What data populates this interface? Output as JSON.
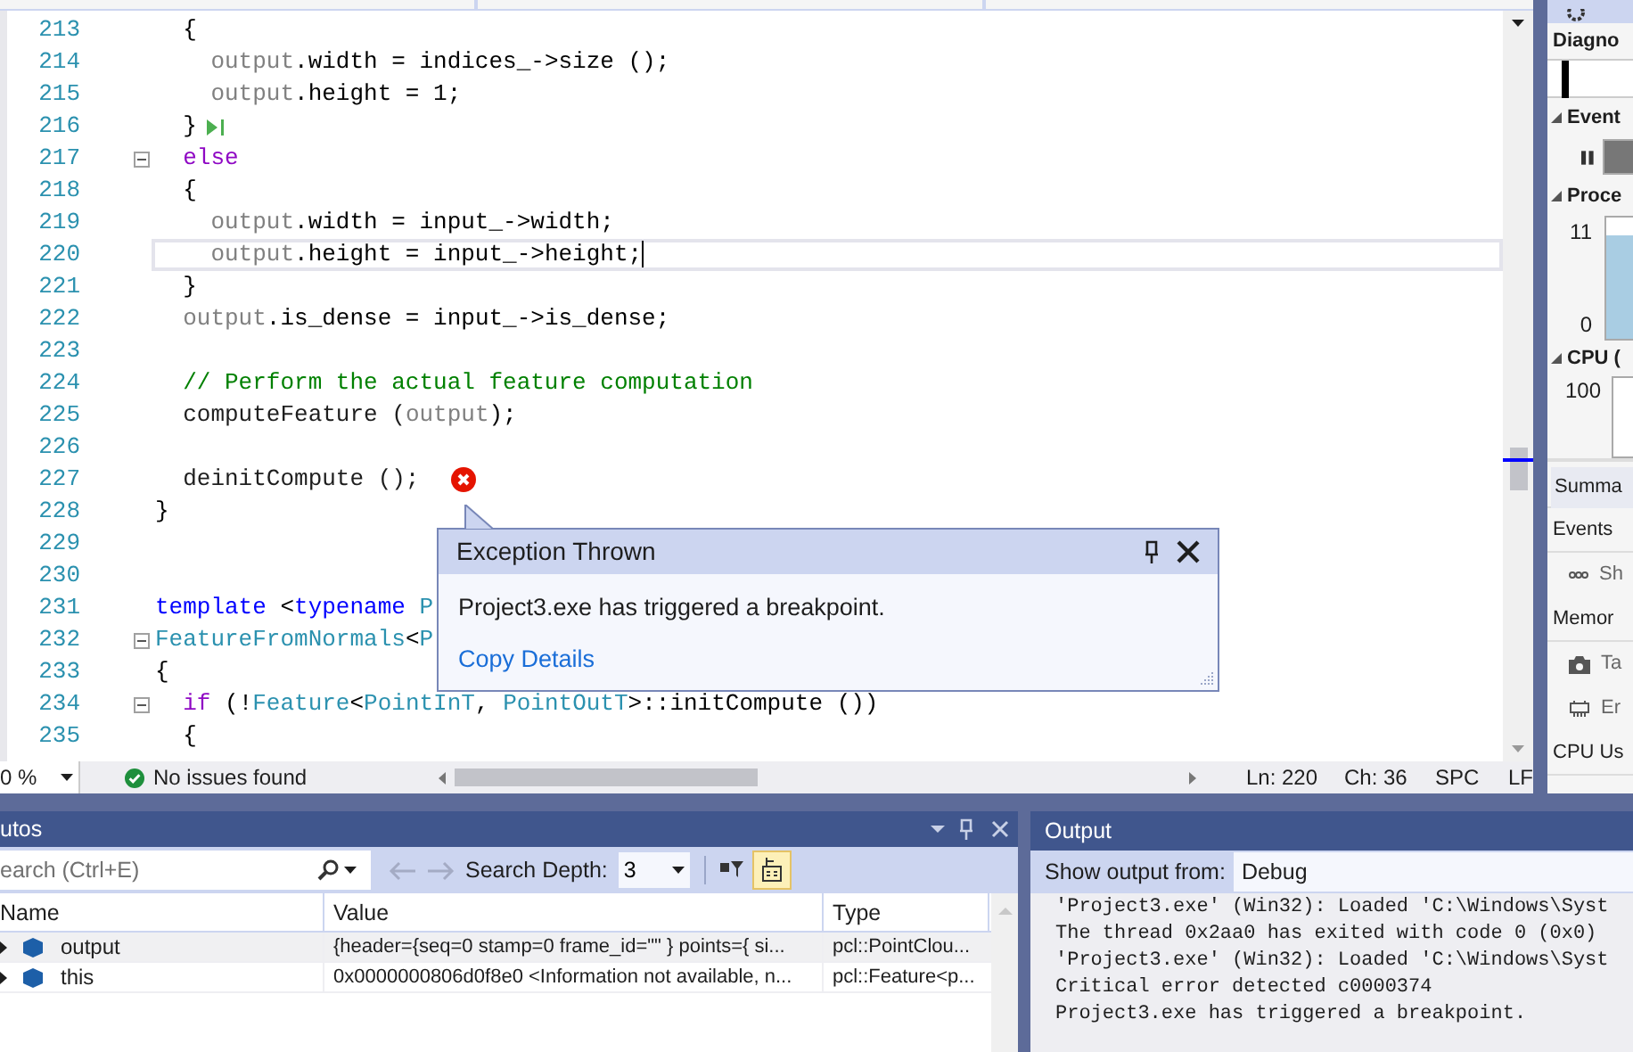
{
  "editor": {
    "lines": [
      {
        "number": "213",
        "tokens": [
          {
            "text": "  {",
            "kind": "plain"
          }
        ]
      },
      {
        "number": "214",
        "tokens": [
          {
            "text": "    output",
            "kind": "local"
          },
          {
            "text": ".width = indices_->size ();",
            "kind": "plain"
          }
        ]
      },
      {
        "number": "215",
        "tokens": [
          {
            "text": "    output",
            "kind": "local"
          },
          {
            "text": ".height = 1;",
            "kind": "plain"
          }
        ]
      },
      {
        "number": "216",
        "tokens": [
          {
            "text": "  }",
            "kind": "plain"
          }
        ],
        "step": true
      },
      {
        "number": "217",
        "tokens": [
          {
            "text": "  else",
            "kind": "control"
          }
        ],
        "fold": true
      },
      {
        "number": "218",
        "tokens": [
          {
            "text": "  {",
            "kind": "plain"
          }
        ]
      },
      {
        "number": "219",
        "tokens": [
          {
            "text": "    output",
            "kind": "local"
          },
          {
            "text": ".width = input_->width;",
            "kind": "plain"
          }
        ]
      },
      {
        "number": "220",
        "tokens": [
          {
            "text": "    output",
            "kind": "local"
          },
          {
            "text": ".height = input_->height;",
            "kind": "plain"
          }
        ],
        "current": true
      },
      {
        "number": "221",
        "tokens": [
          {
            "text": "  }",
            "kind": "plain"
          }
        ]
      },
      {
        "number": "222",
        "tokens": [
          {
            "text": "  output",
            "kind": "local"
          },
          {
            "text": ".is_dense = input_->is_dense;",
            "kind": "plain"
          }
        ]
      },
      {
        "number": "223"
      },
      {
        "number": "224",
        "tokens": [
          {
            "text": "  // Perform the actual feature computation",
            "kind": "comment"
          }
        ]
      },
      {
        "number": "225",
        "tokens": [
          {
            "text": "  computeFeature (",
            "kind": "function"
          },
          {
            "text": "output",
            "kind": "local"
          },
          {
            "text": ");",
            "kind": "plain"
          }
        ]
      },
      {
        "number": "226"
      },
      {
        "number": "227",
        "tokens": [
          {
            "text": "  deinitCompute ();",
            "kind": "function"
          }
        ],
        "error": true
      },
      {
        "number": "228",
        "tokens": [
          {
            "text": "}",
            "kind": "plain"
          }
        ]
      },
      {
        "number": "229"
      },
      {
        "number": "230"
      },
      {
        "number": "231",
        "tokens": [
          {
            "text": "template",
            "kind": "keyword"
          },
          {
            "text": " <",
            "kind": "plain"
          },
          {
            "text": "typename",
            "kind": "keyword"
          },
          {
            "text": " P",
            "kind": "type"
          }
        ]
      },
      {
        "number": "232",
        "tokens": [
          {
            "text": "FeatureFromNormals",
            "kind": "type"
          },
          {
            "text": "<",
            "kind": "plain"
          },
          {
            "text": "P",
            "kind": "type"
          }
        ],
        "fold": true
      },
      {
        "number": "233",
        "tokens": [
          {
            "text": "{",
            "kind": "plain"
          }
        ]
      },
      {
        "number": "234",
        "tokens": [
          {
            "text": "  if",
            "kind": "control"
          },
          {
            "text": " (!",
            "kind": "plain"
          },
          {
            "text": "Feature",
            "kind": "type"
          },
          {
            "text": "<",
            "kind": "plain"
          },
          {
            "text": "PointInT",
            "kind": "type"
          },
          {
            "text": ", ",
            "kind": "plain"
          },
          {
            "text": "PointOutT",
            "kind": "type"
          },
          {
            "text": ">::initCompute ())",
            "kind": "plain"
          }
        ],
        "fold": true
      },
      {
        "number": "235",
        "tokens": [
          {
            "text": "  {",
            "kind": "plain"
          }
        ]
      }
    ],
    "exception": {
      "title": "Exception Thrown",
      "message": "Project3.exe has triggered a breakpoint.",
      "link": "Copy Details"
    },
    "status_bar": {
      "zoom": "0 %",
      "issues": "No issues found",
      "line": "Ln: 220",
      "column": "Ch: 36",
      "whitespace": "SPC",
      "line_ending": "LF"
    }
  },
  "diagnostics": {
    "title": "Diagno",
    "events_heading": "Event",
    "process_heading": "Proce",
    "process_ticks": [
      "11",
      "0"
    ],
    "cpu_heading": "CPU (",
    "cpu_tick": "100",
    "tab": "Summa",
    "list": [
      {
        "kind": "header",
        "label": "Events"
      },
      {
        "kind": "events",
        "label": "Sh"
      },
      {
        "kind": "header",
        "label": "Memor"
      },
      {
        "kind": "snapshot",
        "label": "Ta"
      },
      {
        "kind": "chip",
        "label": "Er"
      },
      {
        "kind": "header",
        "label": "CPU Us"
      }
    ]
  },
  "autos": {
    "title": "utos",
    "search_placeholder": "earch (Ctrl+E)",
    "depth_label": "Search Depth:",
    "depth": "3",
    "raw_toggle_on": true,
    "columns": [
      "Name",
      "Value",
      "Type"
    ],
    "rows": [
      {
        "name": "output",
        "value": "{header={seq=0 stamp=0 frame_id=\"\" } points={ si...",
        "type": "pcl::PointClou...",
        "selected": true
      },
      {
        "name": "this",
        "value": "0x0000000806d0f8e0 <Information not available, n...",
        "type": "pcl::Feature<p...",
        "selected": false
      }
    ]
  },
  "output": {
    "title": "Output",
    "source_label": "Show output from:",
    "source": "Debug",
    "lines": [
      "'Project3.exe' (Win32): Loaded 'C:\\Windows\\Syst",
      "The thread 0x2aa0 has exited with code 0 (0x0)",
      "'Project3.exe' (Win32): Loaded 'C:\\Windows\\Syst",
      "Critical error detected c0000374",
      "Project3.exe has triggered a breakpoint."
    ]
  }
}
